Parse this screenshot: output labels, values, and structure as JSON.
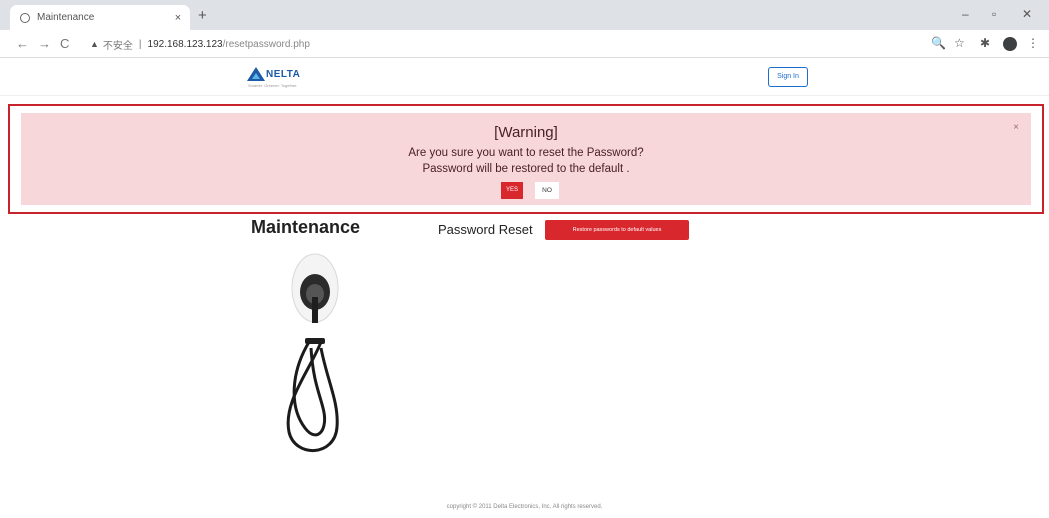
{
  "browser": {
    "tab_title": "Maintenance",
    "tab_close": "×",
    "new_tab": "+",
    "window_controls": {
      "minimize": "–",
      "restore": "▫",
      "close": "✕"
    },
    "nav": {
      "back": "←",
      "forward": "→",
      "reload": "C"
    },
    "address": {
      "insecure_label": "不安全",
      "separator": "|",
      "host": "192.168.123.123",
      "path": "/resetpassword.php"
    },
    "toolbar_icons": {
      "zoom": "🔍",
      "star": "☆",
      "extension": "✱",
      "menu": "⋮"
    }
  },
  "header": {
    "logo_text": "NELTA",
    "logo_tagline": "Smarter. Greener. Together.",
    "signin_label": "Sign In"
  },
  "alert": {
    "title": "[Warning]",
    "line1": "Are you sure you want to reset the Password?",
    "line2": "Password will be restored to the default .",
    "yes_label": "YES",
    "no_label": "NO",
    "close": "×"
  },
  "main": {
    "heading": "Maintenance",
    "password_reset_label": "Password Reset",
    "restore_button_label": "Restore passwords to default values"
  },
  "footer": {
    "copyright": "copyright © 2011 Delta Electronics, Inc.    All rights reserved."
  },
  "colors": {
    "alert_bg": "#f8d7da",
    "alert_border": "#c8232c",
    "danger": "#d9272e",
    "brand_blue": "#1a5aa6"
  }
}
